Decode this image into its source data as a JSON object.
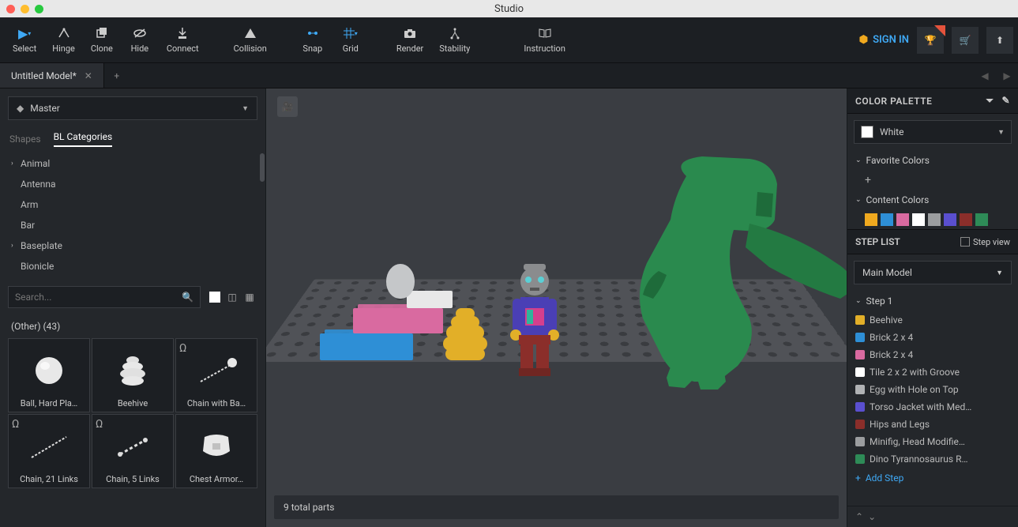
{
  "window": {
    "title": "Studio"
  },
  "toolbar": {
    "buttons": [
      {
        "label": "Select",
        "icon": "▶"
      },
      {
        "label": "Hinge",
        "icon": "⬡"
      },
      {
        "label": "Clone",
        "icon": "❐"
      },
      {
        "label": "Hide",
        "icon": "👁"
      },
      {
        "label": "Connect",
        "icon": "⇣"
      },
      {
        "label": "Collision",
        "icon": "▲"
      },
      {
        "label": "Snap",
        "icon": "⊶"
      },
      {
        "label": "Grid",
        "icon": "#"
      },
      {
        "label": "Render",
        "icon": "📷"
      },
      {
        "label": "Stability",
        "icon": "⚖"
      },
      {
        "label": "Instruction",
        "icon": "▭"
      }
    ],
    "signin": "SIGN IN"
  },
  "tabs": {
    "doc": "Untitled Model*",
    "add": "+"
  },
  "master": {
    "label": "Master"
  },
  "categoryTabs": {
    "a": "Shapes",
    "b": "BL Categories"
  },
  "categories": [
    {
      "label": "Animal",
      "expandable": true
    },
    {
      "label": "Antenna",
      "expandable": false
    },
    {
      "label": "Arm",
      "expandable": false
    },
    {
      "label": "Bar",
      "expandable": false
    },
    {
      "label": "Baseplate",
      "expandable": true
    },
    {
      "label": "Bionicle",
      "expandable": false
    }
  ],
  "search": {
    "placeholder": "Search..."
  },
  "partsGroup": "(Other) (43)",
  "parts": [
    {
      "name": "Ball, Hard Pla…",
      "corner": ""
    },
    {
      "name": "Beehive",
      "corner": ""
    },
    {
      "name": "Chain with Ba…",
      "corner": "Ω"
    },
    {
      "name": "Chain, 21 Links",
      "corner": "Ω"
    },
    {
      "name": "Chain, 5 Links",
      "corner": "Ω"
    },
    {
      "name": "Chest Armor…",
      "corner": ""
    }
  ],
  "status": {
    "text": "9 total parts"
  },
  "colorPalette": {
    "title": "COLOR PALETTE",
    "current": {
      "name": "White",
      "hex": "#ffffff"
    },
    "favTitle": "Favorite Colors",
    "contentTitle": "Content Colors",
    "contentColors": [
      "#f0a91f",
      "#2e8fd6",
      "#d96aa0",
      "#ffffff",
      "#9b9d9f",
      "#5a4fcf",
      "#8b2e2a",
      "#2e8b57"
    ]
  },
  "stepList": {
    "title": "STEP LIST",
    "stepView": "Step view",
    "model": "Main Model",
    "step1": "Step 1",
    "items": [
      {
        "label": "Beehive",
        "color": "#e2af28"
      },
      {
        "label": "Brick 2 x 4",
        "color": "#2e8fd6"
      },
      {
        "label": "Brick 2 x 4",
        "color": "#d96aa0"
      },
      {
        "label": "Tile 2 x 2 with Groove",
        "color": "#ffffff"
      },
      {
        "label": "Egg with Hole on Top",
        "color": "#b0b2b4"
      },
      {
        "label": "Torso Jacket with Med…",
        "color": "#5a4fcf"
      },
      {
        "label": "Hips and Legs",
        "color": "#8b2e2a"
      },
      {
        "label": "Minifig, Head Modifie…",
        "color": "#9b9d9f"
      },
      {
        "label": "Dino Tyrannosaurus R…",
        "color": "#2e8b57"
      }
    ],
    "addStep": "Add Step"
  }
}
